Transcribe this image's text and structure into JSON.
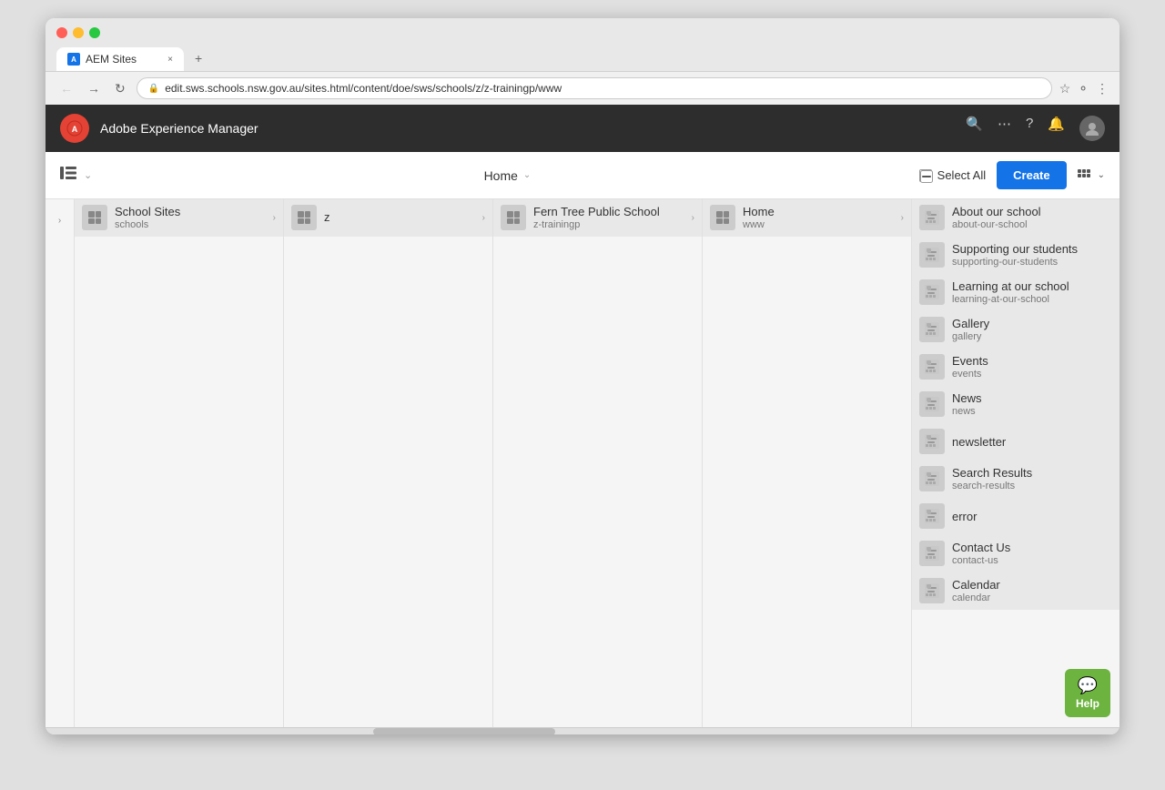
{
  "browser": {
    "tab_title": "AEM Sites",
    "tab_favicon": "A",
    "address": "edit.sws.schools.nsw.gov.au/sites.html/content/doe/sws/schools/z/z-trainingp/www",
    "new_tab_icon": "+",
    "close_icon": "×"
  },
  "aem": {
    "logo": "⬡",
    "title": "Adobe Experience Manager",
    "icons": {
      "search": "🔍",
      "apps": "⋯",
      "help": "?",
      "bell": "🔔",
      "user": "👤"
    }
  },
  "toolbar": {
    "home_label": "Home",
    "select_all_label": "Select All",
    "create_label": "Create",
    "view_icon": "|||",
    "chevron_down": "⌄"
  },
  "columns": [
    {
      "id": "expand-col",
      "type": "narrow"
    },
    {
      "id": "school-sites-col",
      "items": [
        {
          "name": "School Sites",
          "slug": "schools",
          "has_children": true
        }
      ]
    },
    {
      "id": "z-col",
      "items": [
        {
          "name": "z",
          "slug": "",
          "has_children": true
        }
      ]
    },
    {
      "id": "fern-tree-col",
      "items": [
        {
          "name": "Fern Tree Public School",
          "slug": "z-trainingp",
          "has_children": true
        }
      ]
    },
    {
      "id": "home-col",
      "items": [
        {
          "name": "Home",
          "slug": "www",
          "has_children": true
        }
      ]
    },
    {
      "id": "children-col",
      "items": [
        {
          "name": "About our school",
          "slug": "about-our-school",
          "has_children": true
        },
        {
          "name": "Supporting our students",
          "slug": "supporting-our-students",
          "has_children": true
        },
        {
          "name": "Learning at our school",
          "slug": "learning-at-our-school",
          "has_children": true
        },
        {
          "name": "Gallery",
          "slug": "gallery",
          "has_children": true
        },
        {
          "name": "Events",
          "slug": "events",
          "has_children": true
        },
        {
          "name": "News",
          "slug": "news",
          "has_children": true
        },
        {
          "name": "newsletter",
          "slug": "",
          "has_children": true
        },
        {
          "name": "Search Results",
          "slug": "search-results",
          "has_children": true
        },
        {
          "name": "error",
          "slug": "",
          "has_children": true
        },
        {
          "name": "Contact Us",
          "slug": "contact-us",
          "has_children": true
        },
        {
          "name": "Calendar",
          "slug": "calendar",
          "has_children": true
        }
      ]
    }
  ],
  "help": {
    "label": "Help",
    "icon": "💬"
  }
}
